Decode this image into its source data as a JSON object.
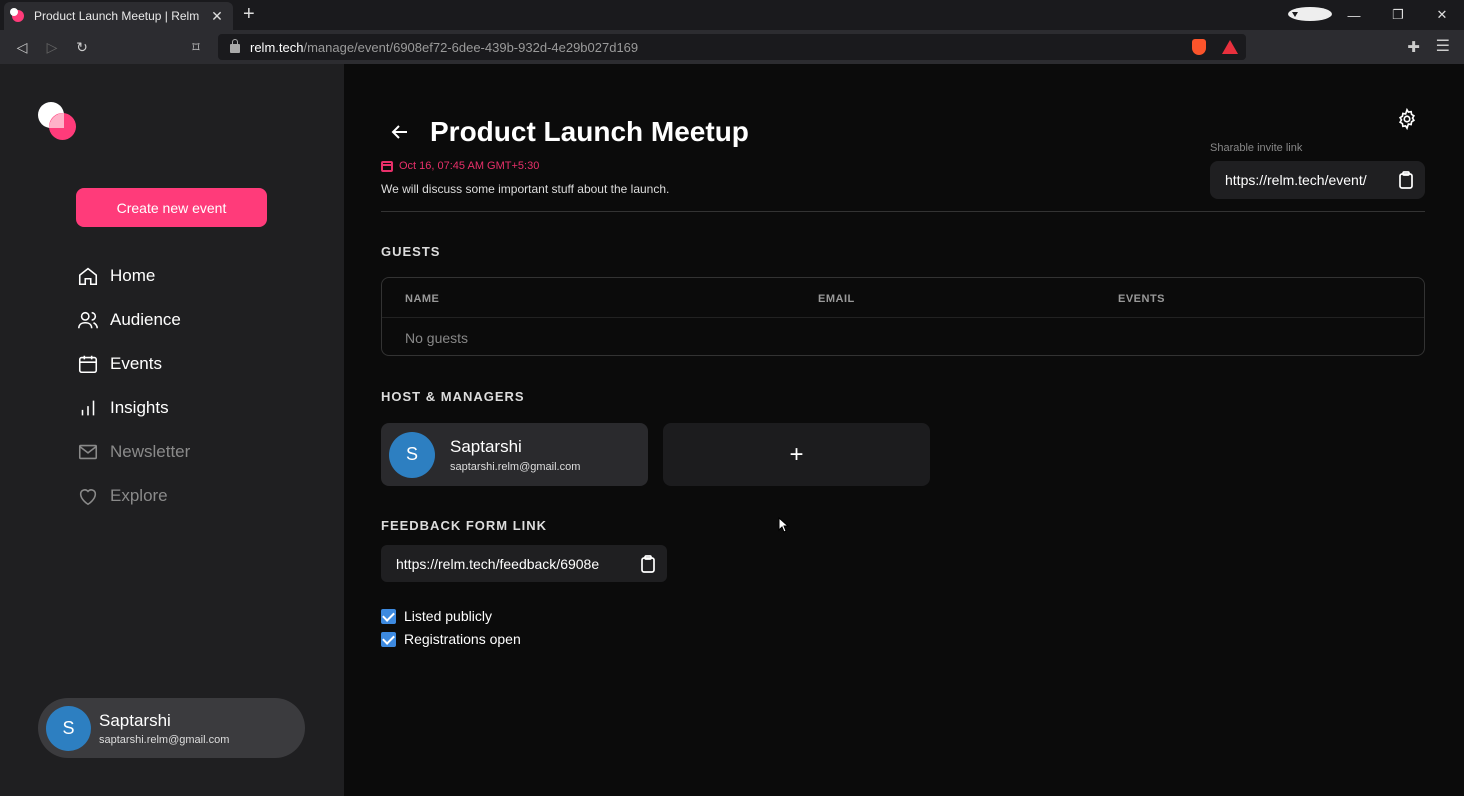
{
  "browser": {
    "tab_title": "Product Launch Meetup | Relm",
    "url_host": "relm.tech",
    "url_path": "/manage/event/6908ef72-6dee-439b-932d-4e29b027d169"
  },
  "sidebar": {
    "create_button": "Create new event",
    "items": [
      {
        "label": "Home",
        "icon": "home-icon"
      },
      {
        "label": "Audience",
        "icon": "users-icon"
      },
      {
        "label": "Events",
        "icon": "calendar-icon"
      },
      {
        "label": "Insights",
        "icon": "bar-chart-icon"
      },
      {
        "label": "Newsletter",
        "icon": "mail-icon"
      },
      {
        "label": "Explore",
        "icon": "heart-icon"
      }
    ],
    "user": {
      "initial": "S",
      "name": "Saptarshi",
      "email": "saptarshi.relm@gmail.com"
    }
  },
  "event": {
    "title": "Product Launch Meetup",
    "date": "Oct 16, 07:45 AM GMT+5:30",
    "description": "We will discuss some important stuff about the launch.",
    "invite_label": "Sharable invite link",
    "invite_link": "https://relm.tech/event/"
  },
  "guests": {
    "section_title": "GUESTS",
    "columns": [
      "NAME",
      "EMAIL",
      "EVENTS"
    ],
    "empty_text": "No guests"
  },
  "hosts": {
    "section_title": "HOST & MANAGERS",
    "list": [
      {
        "initial": "S",
        "name": "Saptarshi",
        "email": "saptarshi.relm@gmail.com"
      }
    ],
    "add_label": "+"
  },
  "feedback": {
    "section_title": "FEEDBACK FORM LINK",
    "link": "https://relm.tech/feedback/6908e"
  },
  "options": {
    "listed_publicly": "Listed publicly",
    "registrations_open": "Registrations open"
  },
  "colors": {
    "accent": "#ff3b7a",
    "checkbox": "#3d8ae0",
    "avatar": "#2d7fc1"
  }
}
